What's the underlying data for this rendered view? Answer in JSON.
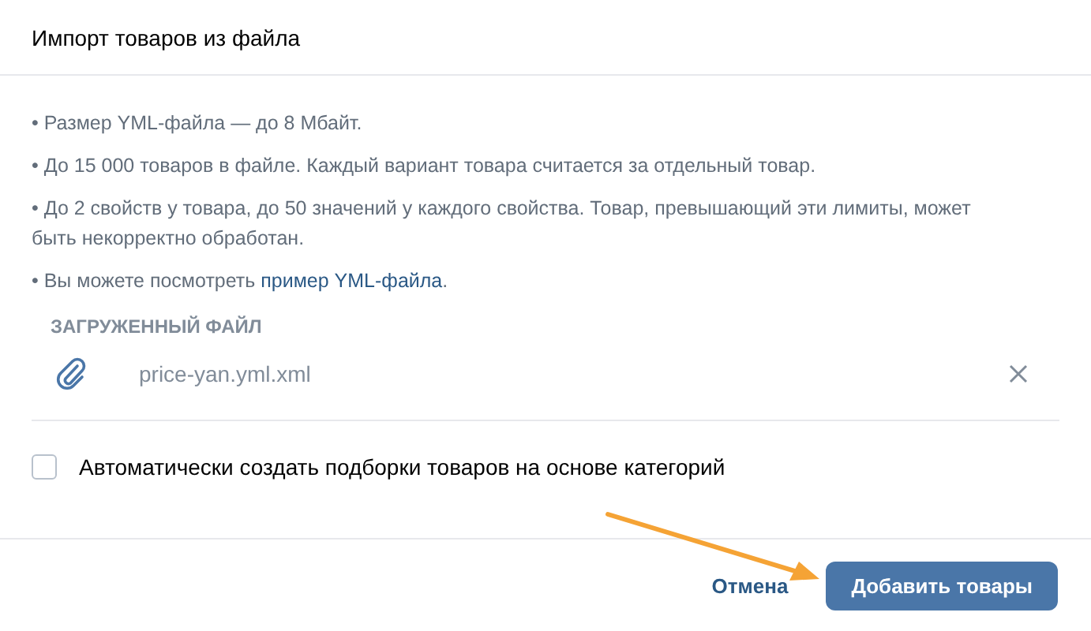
{
  "window": {
    "title": "Импорт товаров из файла"
  },
  "notes": [
    {
      "text": "• Размер YML-файла — до 8 Мбайт."
    },
    {
      "text": "• До 15 000 товаров в файле. Каждый вариант товара считается за отдельный товар."
    },
    {
      "text": "• До 2 свойств у товара, до 50 значений у каждого свойства. Товар, превышающий эти лимиты, может быть некорректно обработан."
    },
    {
      "text": "• Вы можете посмотреть ",
      "link": "пример YML-файла",
      "after": "."
    }
  ],
  "uploaded": {
    "heading": "ЗАГРУЖЕННЫЙ ФАЙЛ",
    "file_name": "price-yan.yml.xml"
  },
  "auto_collections": {
    "label": "Автоматически создать подборки товаров на основе категорий",
    "checked": false
  },
  "buttons": [
    {
      "label": "Отмена",
      "kind": "link"
    },
    {
      "label": "Добавить товары",
      "kind": "primary"
    }
  ],
  "annotation": {
    "kind": "arrow",
    "color": "#f5a335"
  }
}
